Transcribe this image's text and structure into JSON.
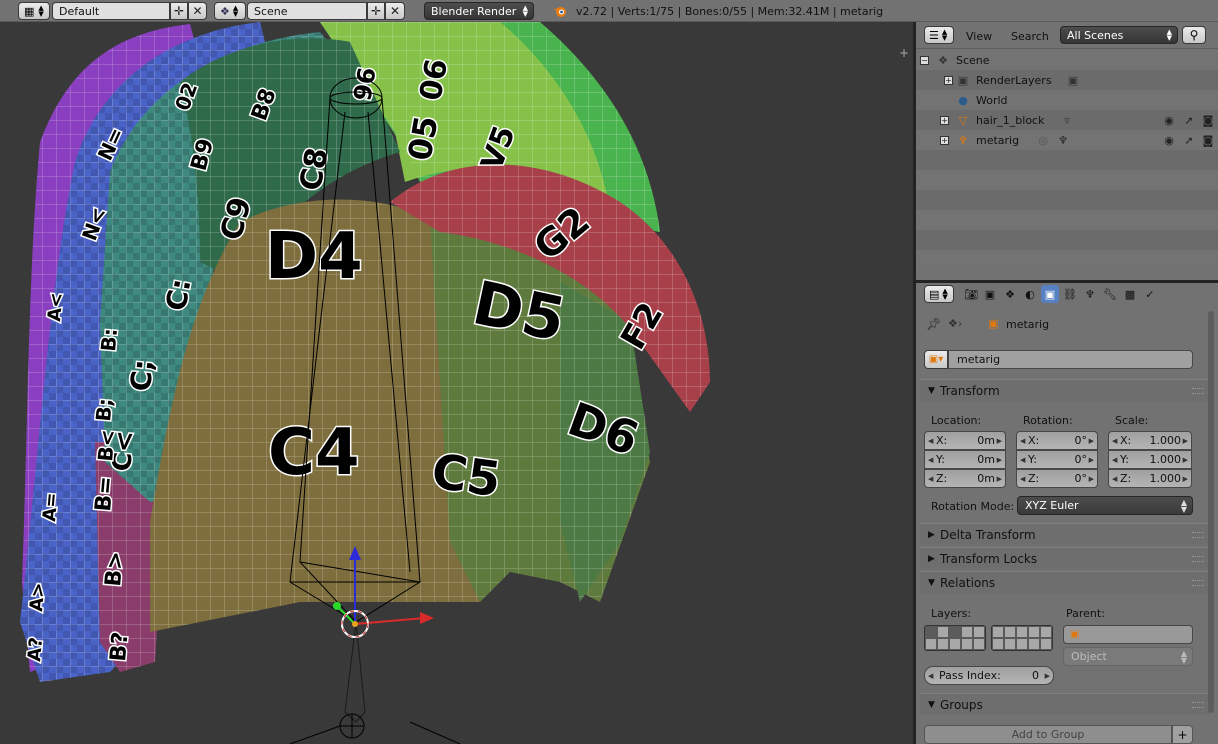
{
  "header": {
    "layout_name": "Default",
    "scene_name": "Scene",
    "render_engine": "Blender Render",
    "stats": "v2.72 | Verts:1/75 | Bones:0/55 | Mem:32.41M | metarig",
    "layout_menu_icon": "screen-layout-icon",
    "scene_menu_icon": "scene-icon",
    "blender_logo_icon": "blender-logo-icon"
  },
  "viewport": {
    "patch_labels": [
      "D4",
      "D5",
      "C4",
      "C5",
      "D6",
      "G2",
      "F2",
      "05",
      "06",
      "V5",
      "C8",
      "C9",
      "B8",
      "B9",
      "C:",
      "C;",
      "C<",
      "B:",
      "B;",
      "B<",
      "B=",
      "B>",
      "B?",
      "A?",
      "A>",
      "A=",
      "A<",
      "N<",
      "N=",
      "02",
      "96"
    ],
    "colors": {
      "purple": "#8a3fc0",
      "blue": "#4a63c8",
      "teal": "#3f8a7f",
      "dark_teal": "#2f6a55",
      "lime": "#86c24a",
      "green": "#49b34e",
      "tan": "#7e6e3d",
      "olive": "#5f7a3d",
      "red": "#a8404a",
      "mauve": "#8a3d6a"
    }
  },
  "outliner": {
    "menu_view": "View",
    "menu_search": "Search",
    "scene_filter": "All Scenes",
    "rows": [
      {
        "label": "Scene"
      },
      {
        "label": "RenderLayers"
      },
      {
        "label": "World"
      },
      {
        "label": "hair_1_block"
      },
      {
        "label": "metarig"
      }
    ]
  },
  "properties": {
    "context_object": "metarig",
    "object_name": "metarig",
    "transform_title": "Transform",
    "location_label": "Location:",
    "rotation_label": "Rotation:",
    "scale_label": "Scale:",
    "location": [
      {
        "axis": "X:",
        "value": "0m"
      },
      {
        "axis": "Y:",
        "value": "0m"
      },
      {
        "axis": "Z:",
        "value": "0m"
      }
    ],
    "rotation": [
      {
        "axis": "X:",
        "value": "0°"
      },
      {
        "axis": "Y:",
        "value": "0°"
      },
      {
        "axis": "Z:",
        "value": "0°"
      }
    ],
    "scale": [
      {
        "axis": "X:",
        "value": "1.000"
      },
      {
        "axis": "Y:",
        "value": "1.000"
      },
      {
        "axis": "Z:",
        "value": "1.000"
      }
    ],
    "rotation_mode_label": "Rotation Mode:",
    "rotation_mode_value": "XYZ Euler",
    "delta_transform_title": "Delta Transform",
    "transform_locks_title": "Transform Locks",
    "relations_title": "Relations",
    "layers_label": "Layers:",
    "parent_label": "Parent:",
    "parent_type": "Object",
    "pass_index_label": "Pass Index:",
    "pass_index_value": "0",
    "groups_title": "Groups",
    "add_to_group": "Add to Group"
  }
}
